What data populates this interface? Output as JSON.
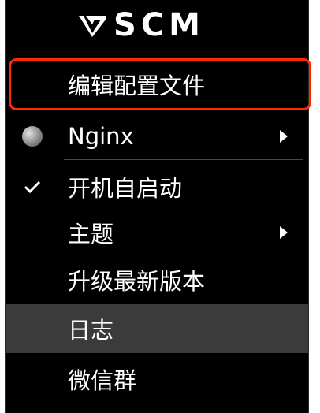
{
  "header": {
    "logo_text": "SCM",
    "logo_icon": "v-checkmark-logo-icon"
  },
  "menu": {
    "items": [
      {
        "label": "编辑配置文件"
      },
      {
        "label": "Nginx",
        "icon": "globe-icon",
        "submenu": true
      },
      {
        "label": "开机自启动",
        "checked": true
      },
      {
        "label": "主题",
        "submenu": true
      },
      {
        "label": "升级最新版本"
      },
      {
        "label": "日志",
        "selected": true
      },
      {
        "label": "微信群"
      }
    ]
  },
  "colors": {
    "menu_background": "#000000",
    "highlight_border": "#ff2a00",
    "selected_background": "#3b3b3b",
    "text": "#ffffff"
  }
}
